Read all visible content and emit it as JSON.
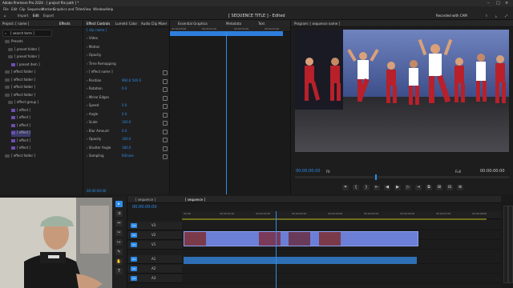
{
  "os_title": "Adobe Premiere Pro 2024 - [ project file path ] *",
  "menu": [
    "File",
    "Edit",
    "Clip",
    "Sequence",
    "Markers",
    "Graphics and Titles",
    "View",
    "Window",
    "Help"
  ],
  "workspace": {
    "left_tabs": [
      "Import",
      "Edit",
      "Export"
    ],
    "active_index": 1,
    "center_title": "[ SEQUENCE TITLE ] - Edited",
    "right_text": "Recorded with CAM"
  },
  "effects_list": {
    "tabs": [
      "Project: [ name ]",
      "Effects"
    ],
    "search": "[ search term ]"
  },
  "tree": [
    {
      "label": "Presets",
      "icon": "folder",
      "indent": 1
    },
    {
      "label": "[ preset folder ]",
      "icon": "folder",
      "indent": 2
    },
    {
      "label": "[ preset folder ]",
      "icon": "folder",
      "indent": 2
    },
    {
      "label": "[ preset item ]",
      "icon": "fx",
      "indent": 3
    },
    {
      "label": "[ effect folder ]",
      "icon": "folder",
      "indent": 1
    },
    {
      "label": "[ effect folder ]",
      "icon": "folder",
      "indent": 1
    },
    {
      "label": "[ effect folder ]",
      "icon": "folder",
      "indent": 1
    },
    {
      "label": "[ effect folder ]",
      "icon": "folder",
      "indent": 1
    },
    {
      "label": "[ effect group ]",
      "icon": "folder",
      "indent": 2
    },
    {
      "label": "[ effect ]",
      "icon": "fx",
      "indent": 3
    },
    {
      "label": "[ effect ]",
      "icon": "fx",
      "indent": 3
    },
    {
      "label": "[ effect ]",
      "icon": "fx",
      "indent": 3
    },
    {
      "label": "[ effect ]",
      "icon": "fx",
      "indent": 3
    },
    {
      "label": "[ effect ]",
      "icon": "fx",
      "indent": 3
    },
    {
      "label": "[ effect ]",
      "icon": "fx",
      "indent": 3
    },
    {
      "label": "[ effect folder ]",
      "icon": "folder",
      "indent": 1
    }
  ],
  "effect_controls": {
    "tabs": [
      "Effect Controls",
      "Lumetri Color",
      "Audio Clip Mixer",
      "Essential Graphics",
      "Metadata",
      "Text"
    ],
    "clip_label": "[ clip name ]",
    "footer_tc": "00:00:00:00",
    "rows": [
      {
        "label": "Video",
        "value": ""
      },
      {
        "label": "Motion",
        "value": ""
      },
      {
        "label": "Opacity",
        "value": ""
      },
      {
        "label": "Time Remapping",
        "value": ""
      },
      {
        "label": "[ effect name ]",
        "value": ""
      },
      {
        "label": "Position",
        "value": "960.0  540.0"
      },
      {
        "label": "Rotation",
        "value": "0.0"
      },
      {
        "label": "Mirror Edges",
        "value": ""
      },
      {
        "label": "Speed",
        "value": "0.0"
      },
      {
        "label": "Angle",
        "value": "0.0"
      },
      {
        "label": "Scale",
        "value": "100.0"
      },
      {
        "label": "Blur Amount",
        "value": "0.0"
      },
      {
        "label": "Opacity",
        "value": "100.0"
      },
      {
        "label": "Shutter Angle",
        "value": "180.0"
      },
      {
        "label": "Sampling",
        "value": "Bilinear"
      }
    ]
  },
  "fx_timeline": {
    "ruler_labels": [
      "00:00:00:00",
      "00:00:01:00",
      "00:00:02:00",
      "00:00:03:00"
    ]
  },
  "program": {
    "title": "Program: [ sequence name ]",
    "tc_left": "00:00:00:00",
    "fit": "Fit",
    "quality": "Full",
    "tc_right": "00:00:00:00",
    "transport": [
      "⏷",
      "{",
      "}",
      "⇤",
      "◀",
      "▶",
      "▷",
      "⇥",
      "⧉",
      "⊞",
      "⊟",
      "⊕"
    ]
  },
  "timeline": {
    "tabs": [
      "[ sequence ]",
      "[ sequence ]"
    ],
    "timecode": "00:00:00:00",
    "ruler_labels": [
      "00:00",
      "00:00:01:00",
      "00:00:02:00",
      "00:00:03:00",
      "00:00:04:00",
      "00:00:05:00",
      "00:00:06:00",
      "00:00:07:00",
      "00:00:08:00"
    ],
    "tracks": [
      {
        "name": "V3",
        "type": "video"
      },
      {
        "name": "V2",
        "type": "video"
      },
      {
        "name": "V1",
        "type": "video"
      },
      {
        "name": "A1",
        "type": "audio"
      },
      {
        "name": "A2",
        "type": "audio"
      },
      {
        "name": "A3",
        "type": "audio"
      }
    ]
  },
  "tools": [
    "▸",
    "⇉",
    "↔",
    "✂",
    "↦",
    "✎",
    "✋",
    "T"
  ],
  "colors": {
    "accent": "#2d8ceb",
    "clip": "#6c7fd6",
    "audio": "#2f6fb5",
    "dancer_red": "#b8202a",
    "stage_blue": "#5d72ad"
  }
}
